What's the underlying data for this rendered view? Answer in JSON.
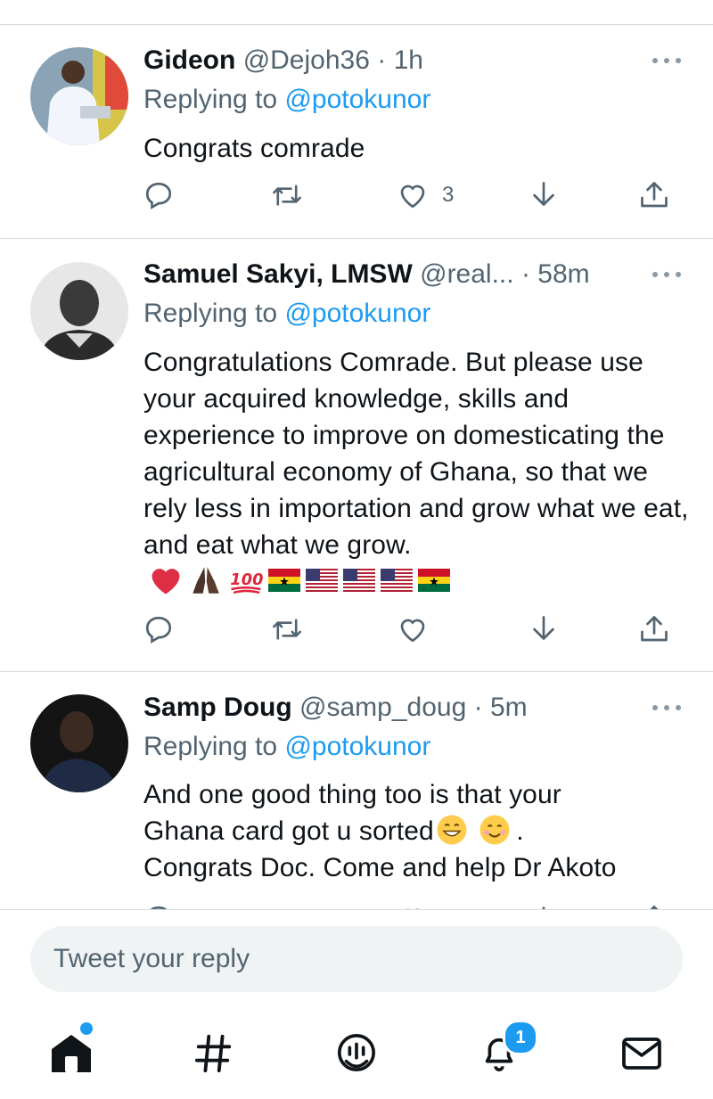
{
  "tweets": [
    {
      "name": "Gideon",
      "handle": "@Dejoh36",
      "dot": "·",
      "time": "1h",
      "replying_prefix": "Replying to",
      "replying_to": "@potokunor",
      "text": "Congrats comrade",
      "like_count": "3"
    },
    {
      "name": "Samuel Sakyi, LMSW",
      "handle": "@real...",
      "dot": "·",
      "time": "58m",
      "replying_prefix": "Replying to",
      "replying_to": "@potokunor",
      "text": "Congratulations Comrade. But please use your acquired knowledge, skills and experience to improve on domesticating the agricultural economy of Ghana, so that we rely less in importation and grow what we eat, and eat what we grow.",
      "emojis": [
        "heart-emoji",
        "praying-hands-emoji",
        "hundred-emoji",
        "ghana-flag",
        "us-flag",
        "us-flag",
        "us-flag",
        "ghana-flag"
      ],
      "like_count": ""
    },
    {
      "name": "Samp Doug",
      "handle": "@samp_doug",
      "dot": "·",
      "time": "5m",
      "replying_prefix": "Replying to",
      "replying_to": "@potokunor",
      "text_line1": "And one good thing too is that your",
      "text_line2": "Ghana card got u sorted",
      "text_line2_end": ".",
      "text_line3": "Congrats Doc. Come and help Dr Akoto",
      "emojis": [
        "grinning-face-emoji",
        "smiling-face-emoji"
      ]
    }
  ],
  "reply_bar": {
    "placeholder": "Tweet your reply"
  },
  "tabbar": {
    "items": [
      "home-icon",
      "explore-hashtag-icon",
      "spaces-icon",
      "notifications-icon",
      "messages-icon"
    ],
    "notification_badge": "1"
  },
  "colors": {
    "accent": "#1d9bf0",
    "secondary_text": "#536471",
    "divider": "#d6dbdf"
  }
}
